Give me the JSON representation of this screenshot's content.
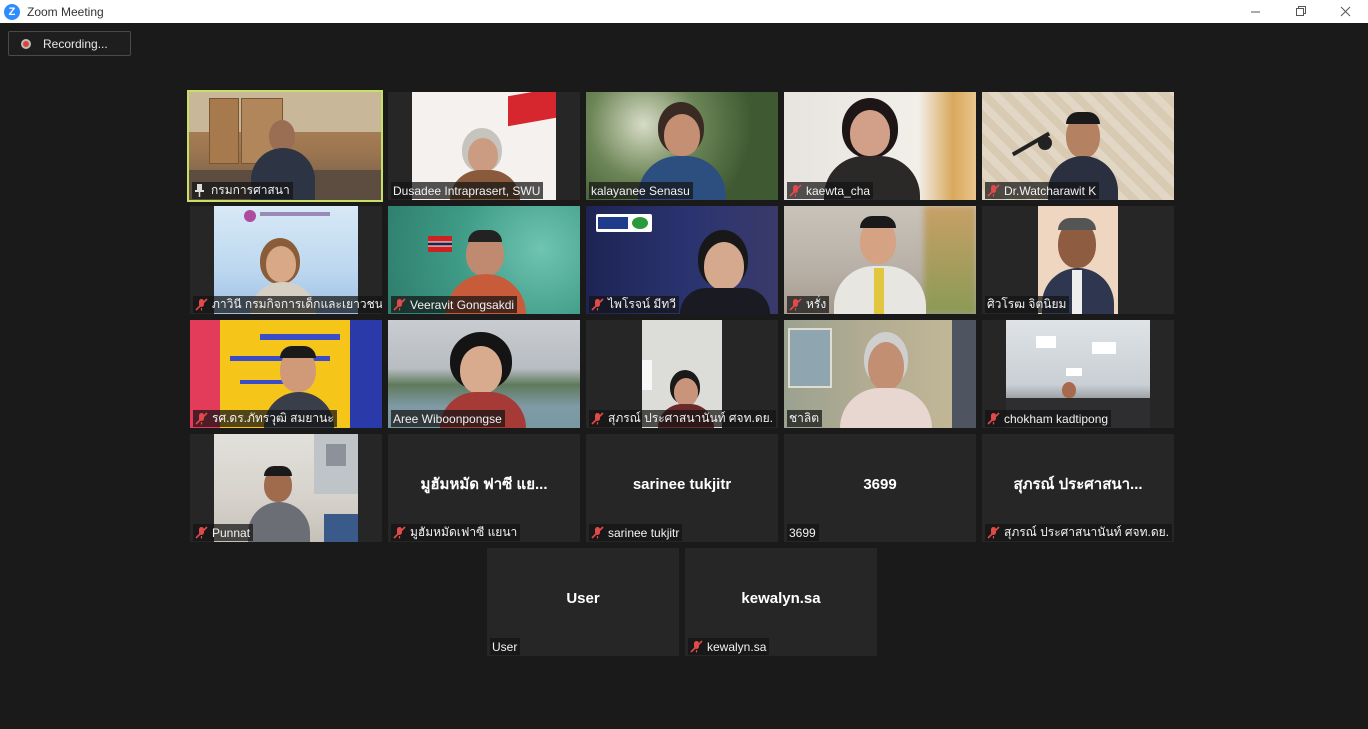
{
  "window": {
    "title": "Zoom Meeting",
    "app_icon": "zoom-logo-icon",
    "controls": [
      "minimize-icon",
      "restore-icon",
      "close-icon"
    ]
  },
  "recording": {
    "label": "Recording..."
  },
  "colors": {
    "background": "#1a1a1a",
    "tile": "#262626",
    "active_speaker_border": "#c8e064",
    "recording_dot": "#e0413a",
    "mute_icon": "#e04a4a"
  },
  "participants": [
    {
      "name": "กรมการศาสนา",
      "status_icon": "pin-icon",
      "active": true
    },
    {
      "name": "Dusadee Intraprasert, SWU",
      "status_icon": ""
    },
    {
      "name": "kalayanee Senasu",
      "status_icon": ""
    },
    {
      "name": "kaewta_cha",
      "status_icon": "mute-icon"
    },
    {
      "name": "Dr.Watcharawit K",
      "status_icon": "mute-icon"
    },
    {
      "name": "ภาวินี กรมกิจการเด็กและเยาวชน",
      "status_icon": "mute-icon"
    },
    {
      "name": "Veeravit Gongsakdi",
      "status_icon": "mute-icon"
    },
    {
      "name": "ไพโรจน์ มีทวี",
      "status_icon": "mute-icon"
    },
    {
      "name": "หรั่ง",
      "status_icon": "mute-icon"
    },
    {
      "name": "ศิวโรฒ จิตนิยม",
      "status_icon": ""
    },
    {
      "name": "รศ.ดร.ภัทรวุฒิ สมยานะ",
      "status_icon": "mute-icon"
    },
    {
      "name": "Aree Wiboonpongse",
      "status_icon": ""
    },
    {
      "name": "สุภรณ์ ประศาสนานันท์ ศจท.ดย.",
      "status_icon": "mute-icon"
    },
    {
      "name": "ชาลิต",
      "status_icon": ""
    },
    {
      "name": "chokham kadtipong",
      "status_icon": "mute-icon"
    },
    {
      "name": "Punnat",
      "status_icon": "mute-icon"
    },
    {
      "name": "มูฮัมหมัดเฟาซี แยนา",
      "display_name": "มูฮัมหมัด ฟาซี แย...",
      "status_icon": "mute-icon"
    },
    {
      "name": "sarinee tukjitr",
      "display_name": "sarinee tukjitr",
      "status_icon": "mute-icon"
    },
    {
      "name": "3699",
      "display_name": "3699",
      "status_icon": ""
    },
    {
      "name": "สุภรณ์ ประศาสนานันท์ ศจท.ดย.",
      "display_name": "สุภรณ์ ประศาสนา...",
      "status_icon": "mute-icon"
    },
    {
      "name": "User",
      "display_name": "User",
      "status_icon": ""
    },
    {
      "name": "kewalyn.sa",
      "display_name": "kewalyn.sa",
      "status_icon": "mute-icon"
    }
  ]
}
